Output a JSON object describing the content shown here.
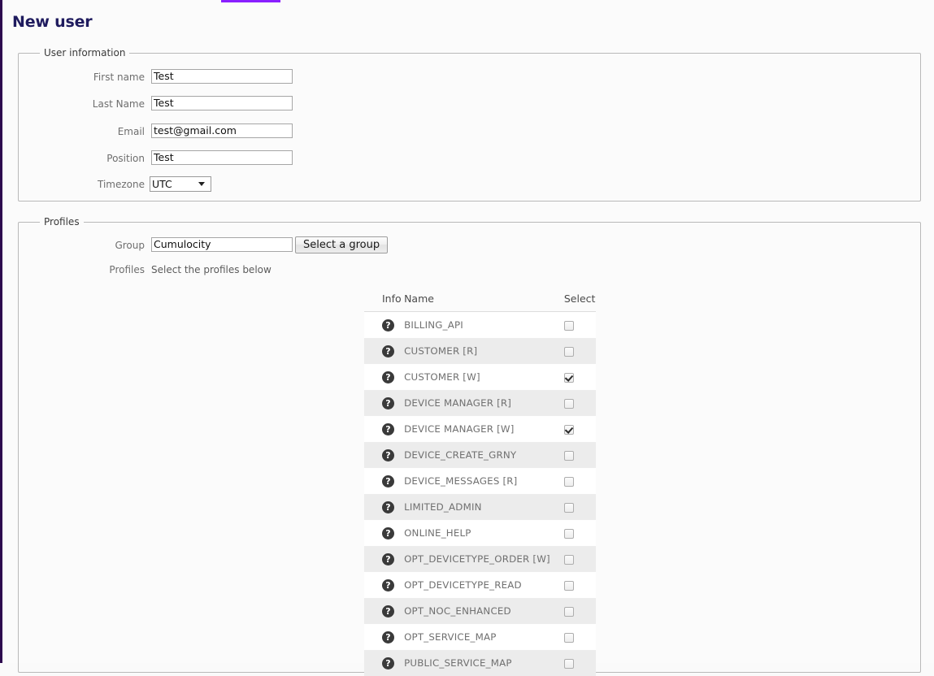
{
  "theme": {
    "accent_purple": "#8a1fff",
    "rail_purple": "#2d0a4e",
    "title_color": "#1f1b5e",
    "row_stripe": "#ececec"
  },
  "page": {
    "title": "New user"
  },
  "user_information": {
    "legend": "User information",
    "fields": [
      {
        "label": "First name",
        "value": "Test",
        "placeholder": ""
      },
      {
        "label": "Last Name",
        "value": "Test",
        "placeholder": ""
      },
      {
        "label": "Email",
        "value": "test@gmail.com",
        "placeholder": ""
      },
      {
        "label": "Position",
        "value": "Test",
        "placeholder": ""
      }
    ],
    "timezone": {
      "label": "Timezone",
      "value": "UTC",
      "options": [
        "UTC"
      ]
    }
  },
  "profiles_section": {
    "legend": "Profiles",
    "group": {
      "label": "Group",
      "value": "Cumulocity",
      "placeholder": "",
      "button_label": "Select a group"
    },
    "profiles": {
      "label": "Profiles",
      "hint": "Select the profiles below"
    },
    "table": {
      "headers": [
        "Info",
        "Name",
        "Select"
      ],
      "info_icon": "question-mark-icon",
      "rows": [
        {
          "name": "BILLING_API",
          "selected": false
        },
        {
          "name": "CUSTOMER [R]",
          "selected": false
        },
        {
          "name": "CUSTOMER [W]",
          "selected": true
        },
        {
          "name": "DEVICE MANAGER [R]",
          "selected": false
        },
        {
          "name": "DEVICE MANAGER [W]",
          "selected": true
        },
        {
          "name": "DEVICE_CREATE_GRNY",
          "selected": false
        },
        {
          "name": "DEVICE_MESSAGES [R]",
          "selected": false
        },
        {
          "name": "LIMITED_ADMIN",
          "selected": false
        },
        {
          "name": "ONLINE_HELP",
          "selected": false
        },
        {
          "name": "OPT_DEVICETYPE_ORDER [W]",
          "selected": false
        },
        {
          "name": "OPT_DEVICETYPE_READ",
          "selected": false
        },
        {
          "name": "OPT_NOC_ENHANCED",
          "selected": false
        },
        {
          "name": "OPT_SERVICE_MAP",
          "selected": false
        },
        {
          "name": "PUBLIC_SERVICE_MAP",
          "selected": false
        }
      ]
    }
  }
}
